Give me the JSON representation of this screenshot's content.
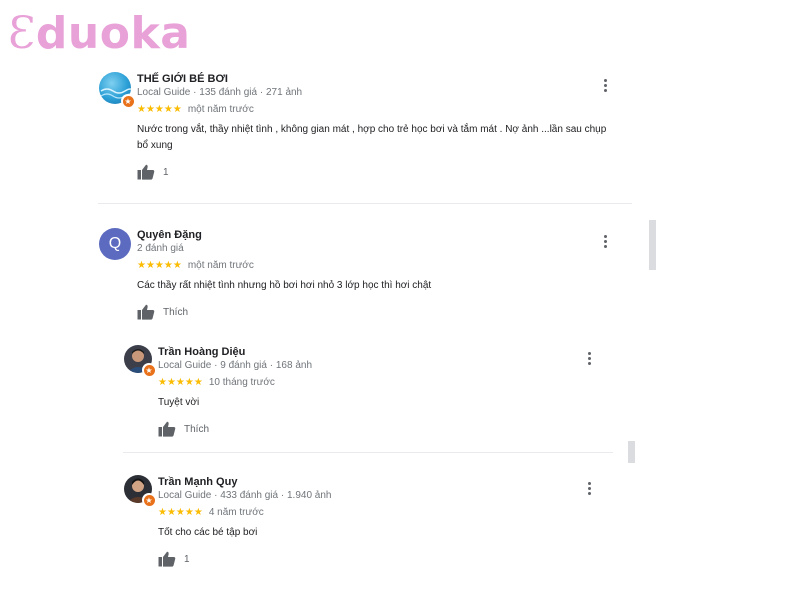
{
  "brand": {
    "logo_first": "Ɛ",
    "logo_rest": "duoka",
    "color": "#e8a2d8"
  },
  "reviews": [
    {
      "name": "THẾ GIỚI BÉ BƠI",
      "meta": "Local Guide · 135 đánh giá · 271 ảnh",
      "stars": "★★★★★",
      "time": "một năm trước",
      "text": "Nước trong vắt, thầy nhiệt tình , không gian mát , hợp cho trẻ học bơi và tắm mát . Nợ ảnh ...lần sau chụp bổ xung",
      "likes": "1",
      "avatar_icon": "pool-photo-avatar"
    },
    {
      "name": "Quyên Đặng",
      "meta": "2 đánh giá",
      "stars": "★★★★★",
      "time": "một năm trước",
      "text": "Các thầy rất nhiệt tình nhưng hồ bơi hơi nhỏ 3 lớp học thì hơi chật",
      "likes": "Thích",
      "avatar_letter": "Q"
    },
    {
      "name": "Trần Hoàng Diệu",
      "meta": "Local Guide · 9 đánh giá · 168 ảnh",
      "stars": "★★★★★",
      "time": "10 tháng trước",
      "text": "Tuyệt vời",
      "likes": "Thích",
      "avatar_icon": "person-photo-avatar"
    },
    {
      "name": "Trần Mạnh Quy",
      "meta": "Local Guide · 433 đánh giá · 1.940 ảnh",
      "stars": "★★★★★",
      "time": "4 năm trước",
      "text": "Tốt cho các bé tập bơi",
      "likes": "1",
      "avatar_icon": "person-photo-avatar"
    }
  ],
  "colors": {
    "star": "#fbbc04",
    "guide_badge": "#e8711a",
    "letter_avatar": "#5c6bc0"
  }
}
